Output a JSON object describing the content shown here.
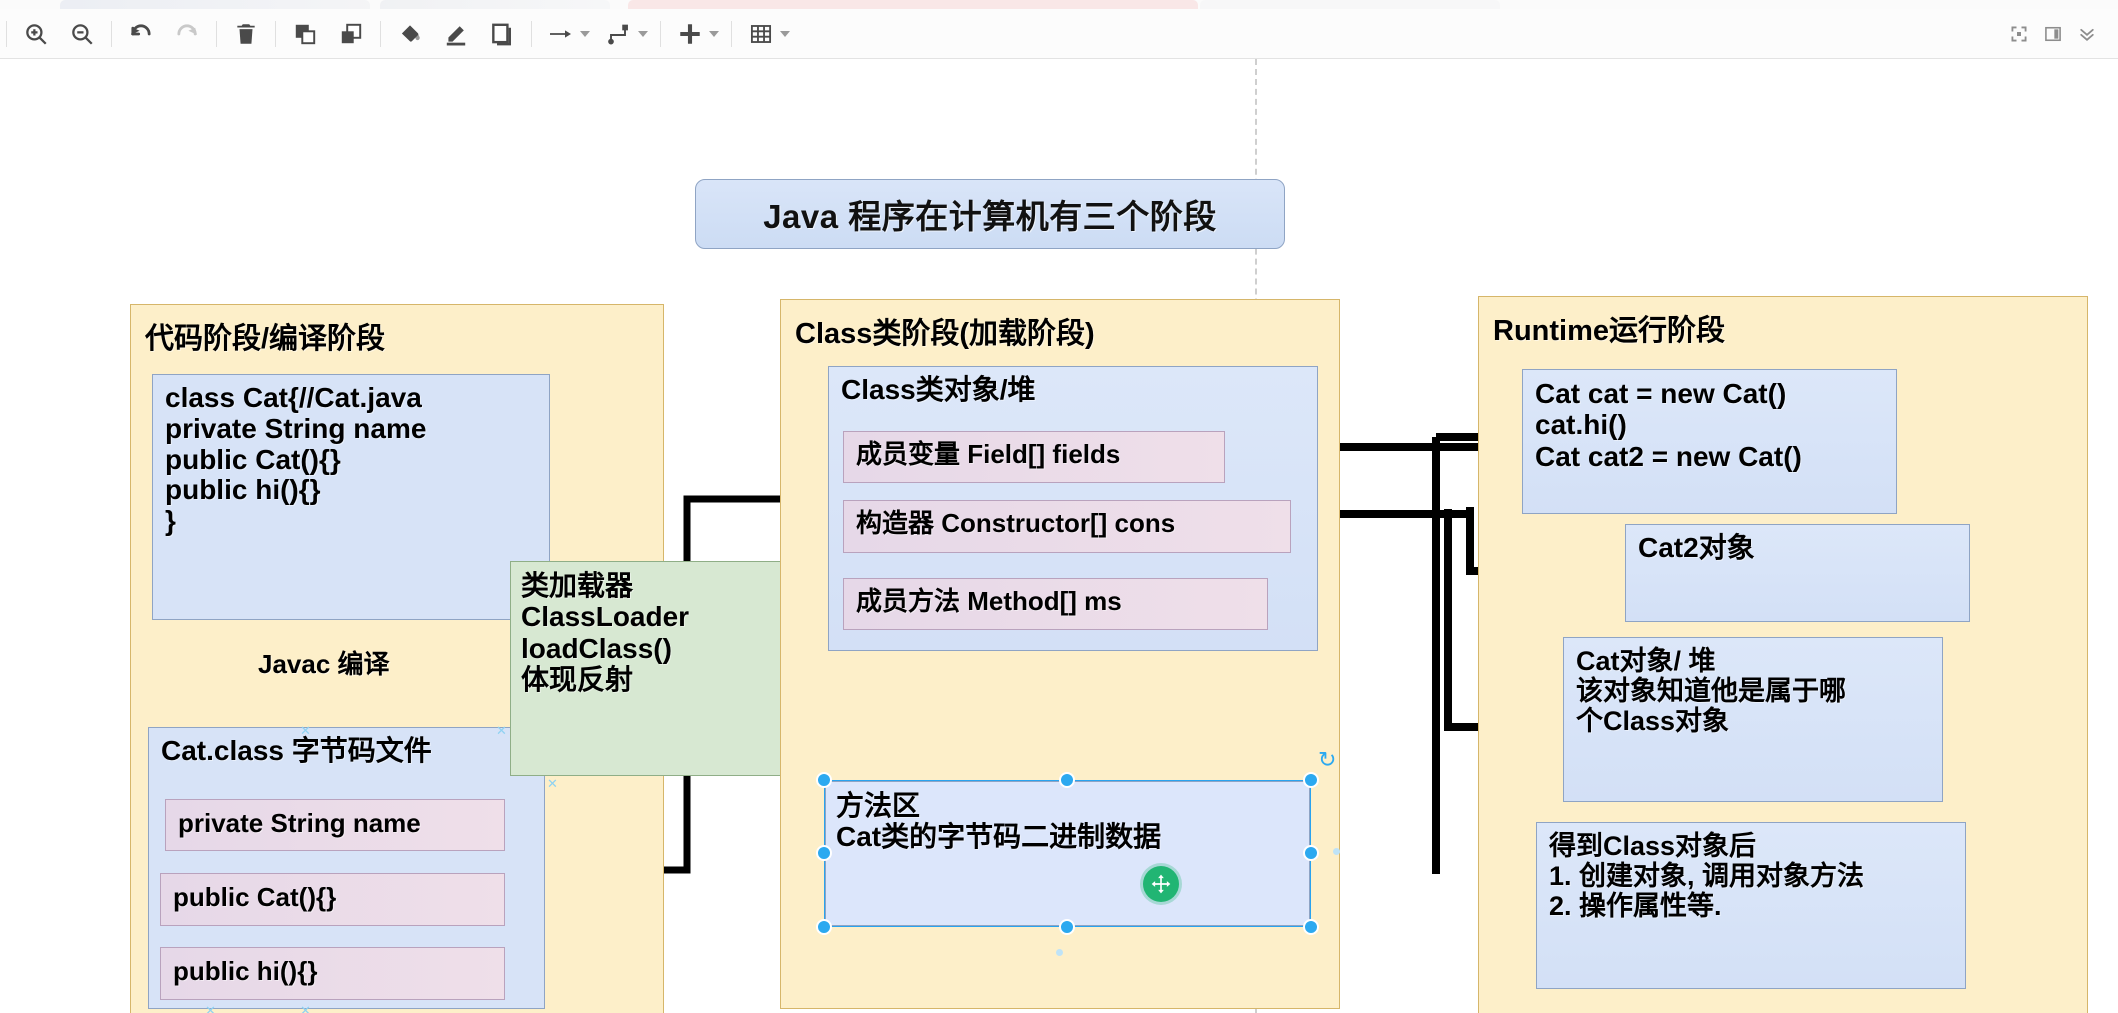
{
  "app": {
    "title_bar_hidden": true
  },
  "toolbar": {
    "left_tools": [
      {
        "name": "zoom-in-icon",
        "label": "Zoom In"
      },
      {
        "name": "zoom-out-icon",
        "label": "Zoom Out"
      },
      {
        "name": "undo-icon",
        "label": "Undo"
      },
      {
        "name": "redo-icon",
        "label": "Redo"
      },
      {
        "name": "delete-icon",
        "label": "Delete"
      },
      {
        "name": "bring-to-front-icon",
        "label": "To Front"
      },
      {
        "name": "send-to-back-icon",
        "label": "To Back"
      },
      {
        "name": "fill-color-icon",
        "label": "Fill Color"
      },
      {
        "name": "line-color-icon",
        "label": "Line Color"
      },
      {
        "name": "shadow-icon",
        "label": "Shadow"
      },
      {
        "name": "connection-arrow-icon",
        "label": "Connection"
      },
      {
        "name": "waypoints-icon",
        "label": "Waypoints"
      },
      {
        "name": "insert-icon",
        "label": "Insert"
      },
      {
        "name": "table-icon",
        "label": "Table"
      }
    ],
    "right_tools": [
      {
        "name": "fullscreen-icon",
        "label": "Fullscreen"
      },
      {
        "name": "format-panel-icon",
        "label": "Format Panel"
      },
      {
        "name": "collapse-icon",
        "label": "Collapse"
      }
    ]
  },
  "diagram": {
    "title": "Java 程序在计算机有三个阶段",
    "stages": {
      "compile": {
        "title": "代码阶段/编译阶段",
        "source_code": "class Cat{//Cat.java\nprivate String name\npublic Cat(){}\npublic hi(){}\n}",
        "arrow_label": "Javac 编译",
        "class_file_title": "Cat.class 字节码文件",
        "members": [
          "private String name",
          "public Cat(){}",
          "public hi(){}"
        ]
      },
      "classloader": {
        "text": "类加载器\nClassLoader\nloadClass()\n体现反射"
      },
      "load": {
        "title": "Class类阶段(加载阶段)",
        "class_object_title": "Class类对象/堆",
        "members": [
          "成员变量 Field[] fields",
          "构造器 Constructor[] cons",
          "成员方法 Method[] ms"
        ],
        "method_area": "方法区\nCat类的字节码二进制数据"
      },
      "runtime": {
        "title": "Runtime运行阶段",
        "code": "Cat cat = new Cat()\ncat.hi()\nCat cat2 = new Cat()",
        "cat2_object": "Cat2对象",
        "cat_object": "Cat对象/ 堆\n该对象知道他是属于哪\n个Class对象",
        "after_class": "得到Class对象后\n1. 创建对象, 调用对象方法\n2. 操作属性等."
      }
    }
  },
  "selection": {
    "selected_shape": "方法区",
    "handles": 8,
    "accent_color": "#2ca9f0",
    "move_badge_color": "#21b573"
  },
  "colors": {
    "stage_fill": "#fdefc9",
    "stage_stroke": "#d6b66a",
    "blue_fill": "#d7e3f7",
    "blue_stroke": "#8fa4c4",
    "pink_fill": "#e9dbeb",
    "green_fill": "#d7e8d2"
  }
}
